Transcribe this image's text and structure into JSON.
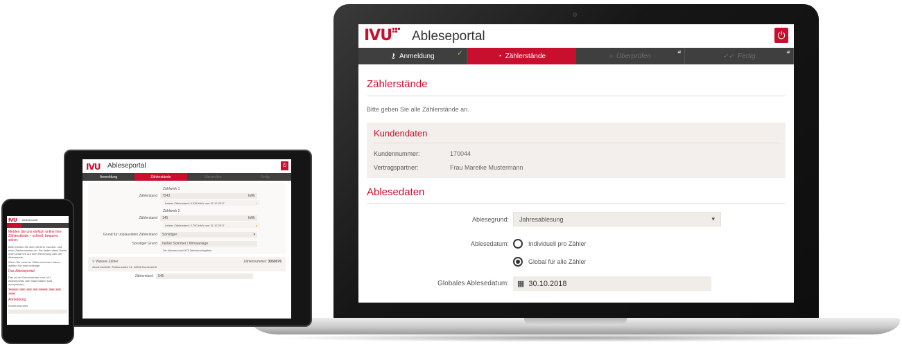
{
  "laptop": {
    "logo": "IVU",
    "app_title": "Ableseportal",
    "steps": [
      {
        "label": "Anmeldung",
        "state": "done"
      },
      {
        "label": "Zählerstände",
        "state": "active"
      },
      {
        "label": "Überprüfen",
        "state": "locked"
      },
      {
        "label": "Fertig",
        "state": "locked"
      }
    ],
    "page_heading": "Zählerstände",
    "intro": "Bitte geben Sie alle Zählerstände an.",
    "kundendaten": {
      "title": "Kundendaten",
      "kundennummer_label": "Kundennummer:",
      "kundennummer": "170044",
      "partner_label": "Vertragspartner:",
      "partner": "Frau Mareike Mustermann"
    },
    "ablesedaten": {
      "title": "Ablesedaten",
      "grund_label": "Ablesegrund:",
      "grund_value": "Jahresablesung",
      "datum_label": "Ablesedatum:",
      "opt_individuell": "Individuell pro Zähler",
      "opt_global": "Global für alle Zähler",
      "global_label": "Globales Ablesedatum:",
      "global_value": "30.10.2018"
    }
  },
  "tablet": {
    "logo": "IVU",
    "app_title": "Ableseportal",
    "steps": [
      "Anmeldung",
      "Zählerstände",
      "Überprüfen",
      "Fertig"
    ],
    "zaehler1": {
      "title": "Zählwerk 1",
      "label": "Zählerstand",
      "value": "7243",
      "unit": "kWh",
      "hint": "Letzter Zählerstand: 6.538 kWh vom 31.12.2017"
    },
    "zaehler2": {
      "title": "Zählwerk 2",
      "label": "Zählerstand",
      "value": "145",
      "unit": "kWh",
      "hint": "Letzter Zählerstand: 2.790 kWh vom 31.12.2017"
    },
    "grund_label": "Grund für unplausiblen Zählerstand",
    "grund_value": "Sonstiger",
    "sonst_label": "Sonstiger Grund",
    "sonst_value": "heißer Sommer / Klimaanlage",
    "chars_left": "Sie können noch 973 Zeichen eingeben",
    "water_title": "Wasser-Zähler",
    "water_address": "Abnahmestelle: Rathausallee 31, 22846 Norderstedt",
    "water_number_label": "Zählernummer:",
    "water_number": "3050076",
    "next_label": "Zählerstand",
    "next_value": "545"
  },
  "phone": {
    "logo": "IVU",
    "app_title": "Ableseportal",
    "message": "Melden Sie uns einfach online Ihre Zählerstände – schnell, bequem, sicher.",
    "text1": "Bitte melden Sie sich mit Ihrer Kunden- und einer Zählernummer an. Sie finden diese Daten unter anderem auf Ihrer Rechnung oder der Ablesekarte.",
    "text2": "Wenn Sie mehrere Zählernummern haben, wählen Sie eine beliebige.",
    "portal_heading": "Das Ableseportal",
    "text3": "Das ist der Demonstrator vom IVU-Ableseportal. Alle Stammdaten sind anonymisiert.",
    "tags": [
      "Beispiele:",
      "3001",
      "1234",
      "555",
      "1234578",
      "3055",
      "5434",
      "12345"
    ],
    "login_heading": "Anmeldung",
    "kunden_label": "Kundennummer"
  },
  "colors": {
    "brand_red": "#c8102e",
    "step_bar": "#3f3f3f",
    "check_green": "#6ebe4a"
  }
}
